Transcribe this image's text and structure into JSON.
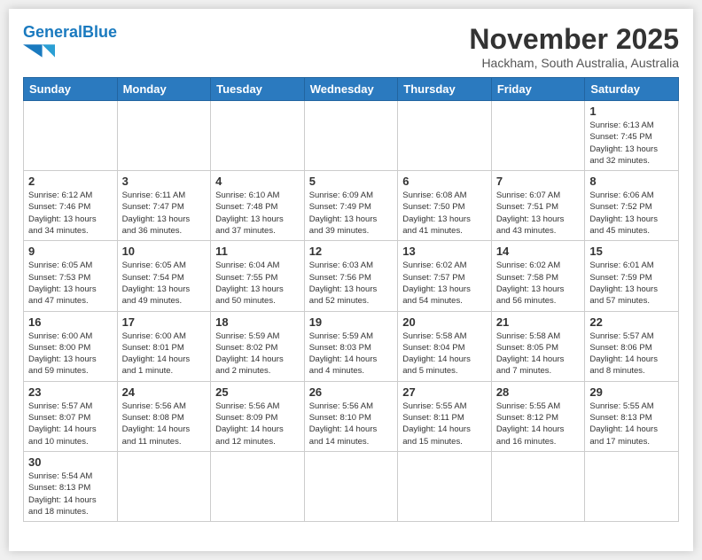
{
  "header": {
    "logo_general": "General",
    "logo_blue": "Blue",
    "month": "November 2025",
    "location": "Hackham, South Australia, Australia"
  },
  "weekdays": [
    "Sunday",
    "Monday",
    "Tuesday",
    "Wednesday",
    "Thursday",
    "Friday",
    "Saturday"
  ],
  "weeks": [
    [
      {
        "day": "",
        "info": ""
      },
      {
        "day": "",
        "info": ""
      },
      {
        "day": "",
        "info": ""
      },
      {
        "day": "",
        "info": ""
      },
      {
        "day": "",
        "info": ""
      },
      {
        "day": "",
        "info": ""
      },
      {
        "day": "1",
        "info": "Sunrise: 6:13 AM\nSunset: 7:45 PM\nDaylight: 13 hours\nand 32 minutes."
      }
    ],
    [
      {
        "day": "2",
        "info": "Sunrise: 6:12 AM\nSunset: 7:46 PM\nDaylight: 13 hours\nand 34 minutes."
      },
      {
        "day": "3",
        "info": "Sunrise: 6:11 AM\nSunset: 7:47 PM\nDaylight: 13 hours\nand 36 minutes."
      },
      {
        "day": "4",
        "info": "Sunrise: 6:10 AM\nSunset: 7:48 PM\nDaylight: 13 hours\nand 37 minutes."
      },
      {
        "day": "5",
        "info": "Sunrise: 6:09 AM\nSunset: 7:49 PM\nDaylight: 13 hours\nand 39 minutes."
      },
      {
        "day": "6",
        "info": "Sunrise: 6:08 AM\nSunset: 7:50 PM\nDaylight: 13 hours\nand 41 minutes."
      },
      {
        "day": "7",
        "info": "Sunrise: 6:07 AM\nSunset: 7:51 PM\nDaylight: 13 hours\nand 43 minutes."
      },
      {
        "day": "8",
        "info": "Sunrise: 6:06 AM\nSunset: 7:52 PM\nDaylight: 13 hours\nand 45 minutes."
      }
    ],
    [
      {
        "day": "9",
        "info": "Sunrise: 6:05 AM\nSunset: 7:53 PM\nDaylight: 13 hours\nand 47 minutes."
      },
      {
        "day": "10",
        "info": "Sunrise: 6:05 AM\nSunset: 7:54 PM\nDaylight: 13 hours\nand 49 minutes."
      },
      {
        "day": "11",
        "info": "Sunrise: 6:04 AM\nSunset: 7:55 PM\nDaylight: 13 hours\nand 50 minutes."
      },
      {
        "day": "12",
        "info": "Sunrise: 6:03 AM\nSunset: 7:56 PM\nDaylight: 13 hours\nand 52 minutes."
      },
      {
        "day": "13",
        "info": "Sunrise: 6:02 AM\nSunset: 7:57 PM\nDaylight: 13 hours\nand 54 minutes."
      },
      {
        "day": "14",
        "info": "Sunrise: 6:02 AM\nSunset: 7:58 PM\nDaylight: 13 hours\nand 56 minutes."
      },
      {
        "day": "15",
        "info": "Sunrise: 6:01 AM\nSunset: 7:59 PM\nDaylight: 13 hours\nand 57 minutes."
      }
    ],
    [
      {
        "day": "16",
        "info": "Sunrise: 6:00 AM\nSunset: 8:00 PM\nDaylight: 13 hours\nand 59 minutes."
      },
      {
        "day": "17",
        "info": "Sunrise: 6:00 AM\nSunset: 8:01 PM\nDaylight: 14 hours\nand 1 minute."
      },
      {
        "day": "18",
        "info": "Sunrise: 5:59 AM\nSunset: 8:02 PM\nDaylight: 14 hours\nand 2 minutes."
      },
      {
        "day": "19",
        "info": "Sunrise: 5:59 AM\nSunset: 8:03 PM\nDaylight: 14 hours\nand 4 minutes."
      },
      {
        "day": "20",
        "info": "Sunrise: 5:58 AM\nSunset: 8:04 PM\nDaylight: 14 hours\nand 5 minutes."
      },
      {
        "day": "21",
        "info": "Sunrise: 5:58 AM\nSunset: 8:05 PM\nDaylight: 14 hours\nand 7 minutes."
      },
      {
        "day": "22",
        "info": "Sunrise: 5:57 AM\nSunset: 8:06 PM\nDaylight: 14 hours\nand 8 minutes."
      }
    ],
    [
      {
        "day": "23",
        "info": "Sunrise: 5:57 AM\nSunset: 8:07 PM\nDaylight: 14 hours\nand 10 minutes."
      },
      {
        "day": "24",
        "info": "Sunrise: 5:56 AM\nSunset: 8:08 PM\nDaylight: 14 hours\nand 11 minutes."
      },
      {
        "day": "25",
        "info": "Sunrise: 5:56 AM\nSunset: 8:09 PM\nDaylight: 14 hours\nand 12 minutes."
      },
      {
        "day": "26",
        "info": "Sunrise: 5:56 AM\nSunset: 8:10 PM\nDaylight: 14 hours\nand 14 minutes."
      },
      {
        "day": "27",
        "info": "Sunrise: 5:55 AM\nSunset: 8:11 PM\nDaylight: 14 hours\nand 15 minutes."
      },
      {
        "day": "28",
        "info": "Sunrise: 5:55 AM\nSunset: 8:12 PM\nDaylight: 14 hours\nand 16 minutes."
      },
      {
        "day": "29",
        "info": "Sunrise: 5:55 AM\nSunset: 8:13 PM\nDaylight: 14 hours\nand 17 minutes."
      }
    ],
    [
      {
        "day": "30",
        "info": "Sunrise: 5:54 AM\nSunset: 8:13 PM\nDaylight: 14 hours\nand 18 minutes."
      },
      {
        "day": "",
        "info": ""
      },
      {
        "day": "",
        "info": ""
      },
      {
        "day": "",
        "info": ""
      },
      {
        "day": "",
        "info": ""
      },
      {
        "day": "",
        "info": ""
      },
      {
        "day": "",
        "info": ""
      }
    ]
  ]
}
